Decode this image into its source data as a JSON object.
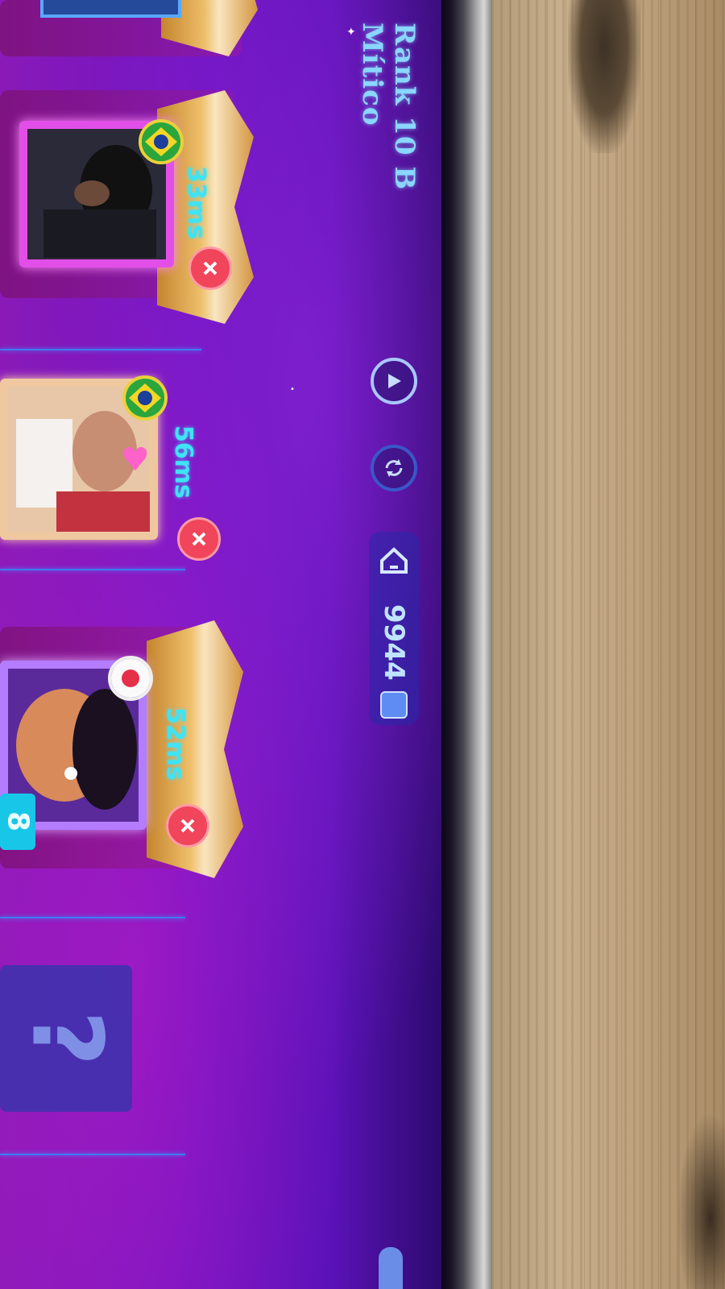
{
  "topbar": {
    "rank_title": "Rank 10 B",
    "rank_tier": "Mítico",
    "play_icon": "play-circle-icon",
    "refresh_icon": "refresh-icon",
    "coins_value": "9944"
  },
  "players": [
    {
      "ping": "33ms",
      "flag": "brazil-flag"
    },
    {
      "ping": "56ms",
      "flag": "brazil-flag"
    },
    {
      "ping": "52ms",
      "flag": "japan-flag"
    }
  ],
  "empty_slot": {
    "label": "?"
  },
  "badge": {
    "label": "8"
  },
  "colors": {
    "screen_bg": "#6f14c2",
    "ping_text": "#3fe3f5",
    "kick_button": "#f0455a",
    "coin_panel": "#2828aa",
    "rank_text": "#8ad6ff"
  }
}
